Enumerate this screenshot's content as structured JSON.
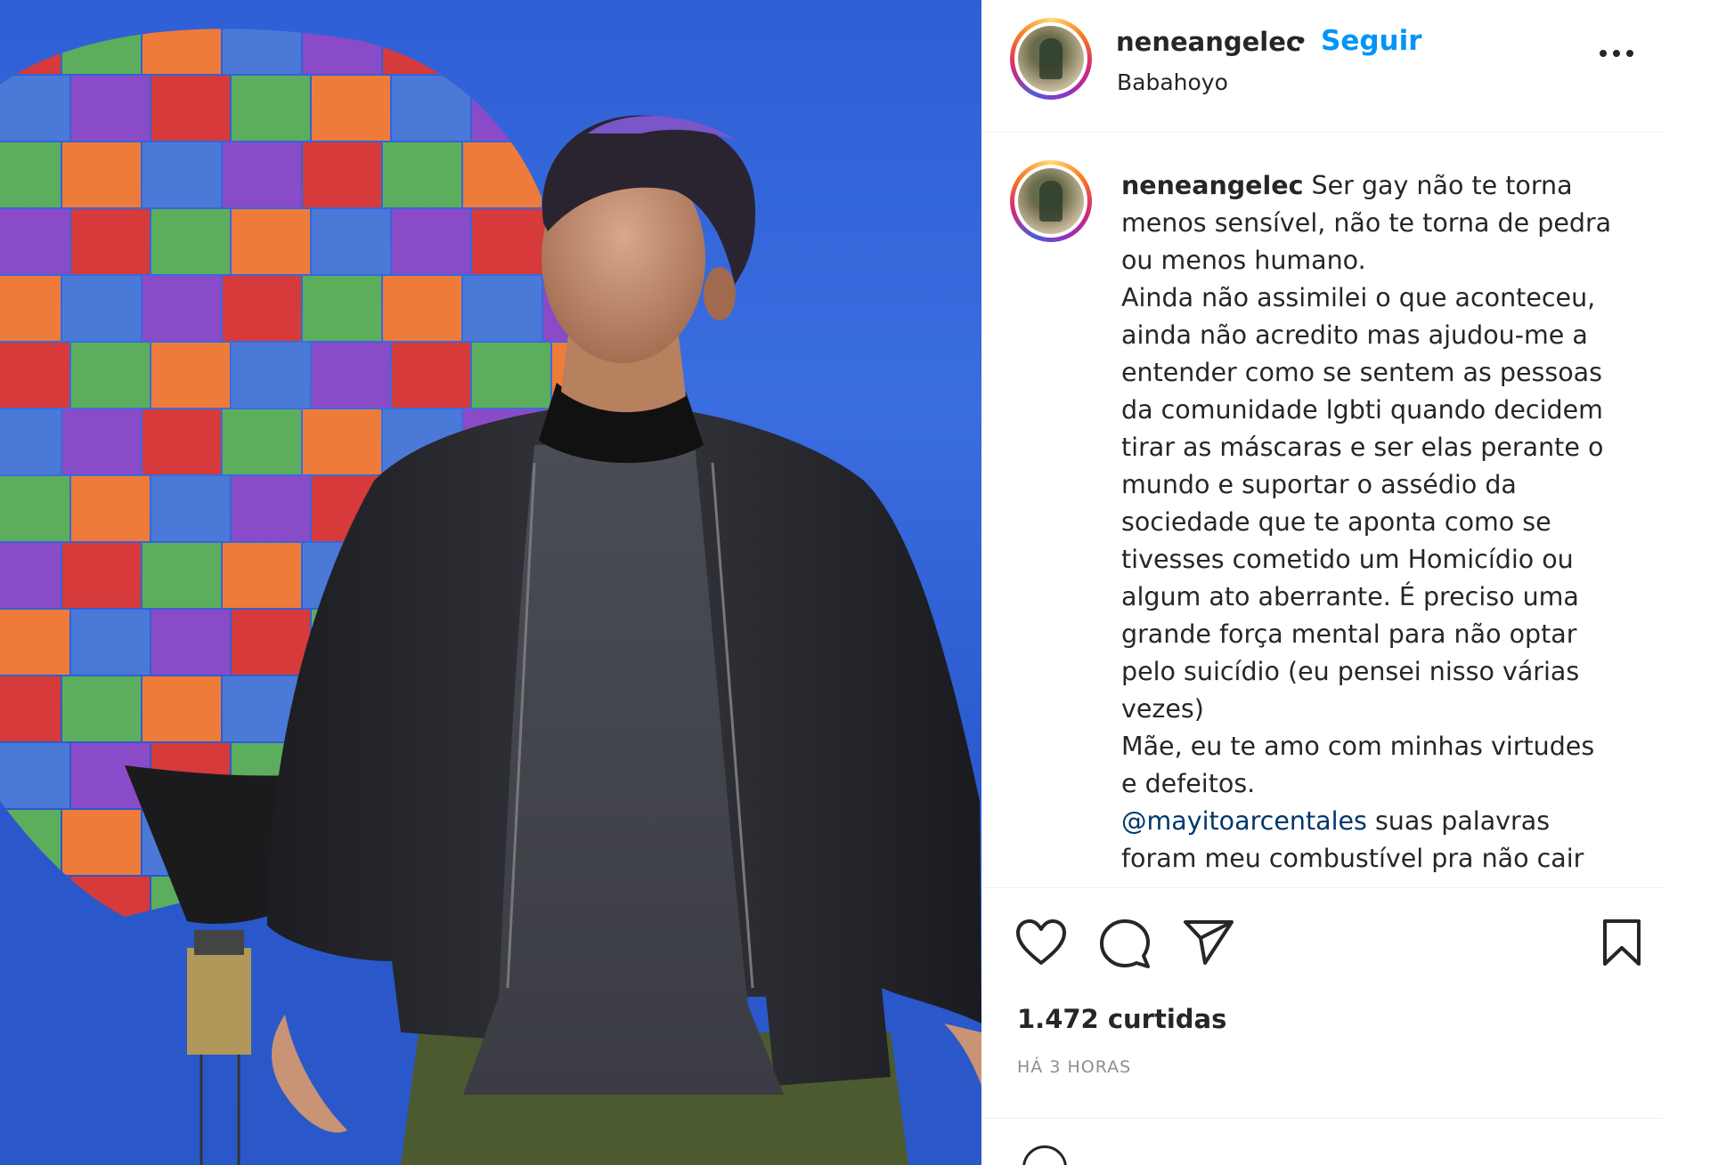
{
  "post": {
    "username": "neneangelec",
    "separator": "•",
    "follow_label": "Seguir",
    "location": "Babahoyo",
    "more_icon": "more-horizontal-icon"
  },
  "caption": {
    "username": "neneangelec",
    "lines": [
      "Ser gay não te torna",
      "menos sensível, não te torna de pedra",
      "ou menos humano.",
      "Ainda não assimilei o que aconteceu,",
      "ainda não acredito mas ajudou-me a",
      "entender como se sentem as pessoas",
      "da comunidade lgbti quando decidem",
      "tirar as máscaras e ser elas perante o",
      "mundo e suportar o assédio da",
      "sociedade que te aponta como se",
      "tivesses cometido um Homicídio ou",
      "algum ato aberrante. É preciso uma",
      "grande força mental para não optar",
      "pelo suicídio (eu pensei nisso várias",
      "vezes)",
      "Mãe, eu te amo com minhas virtudes",
      "e defeitos."
    ],
    "mention": "@mayitoarcentales",
    "mention_rest": " suas palavras",
    "last_line": "foram meu combustível pra não cair"
  },
  "actions": {
    "like_icon": "heart-icon",
    "comment_icon": "comment-icon",
    "share_icon": "send-icon",
    "save_icon": "bookmark-icon"
  },
  "stats": {
    "likes": "1.472 curtidas",
    "time": "HÁ 3 HORAS"
  },
  "colors": {
    "link_blue": "#0095f6",
    "mention_blue": "#00376b",
    "text": "#262626",
    "muted": "#8e8e8e",
    "sky": "#2f5fd6"
  }
}
